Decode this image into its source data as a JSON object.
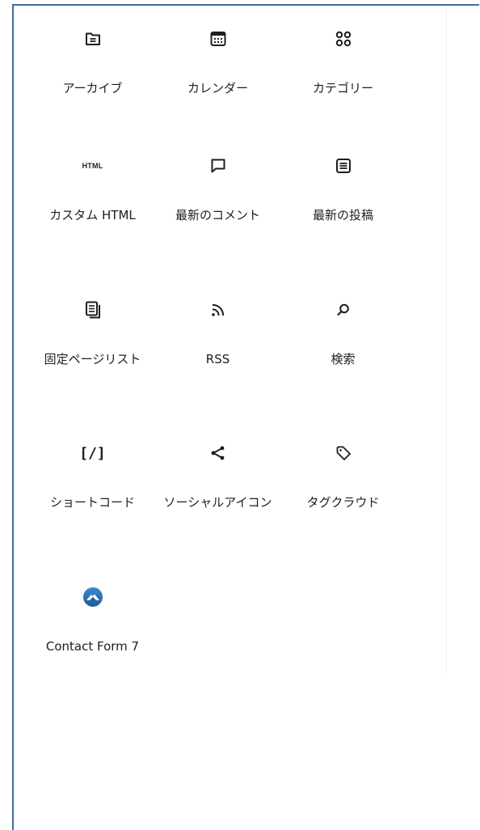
{
  "blocks": [
    {
      "label": "アーカイブ",
      "icon": "archive-icon"
    },
    {
      "label": "カレンダー",
      "icon": "calendar-icon"
    },
    {
      "label": "カテゴリー",
      "icon": "categories-icon"
    },
    {
      "label": "カスタム HTML",
      "icon": "html-icon",
      "icon_text": "HTML"
    },
    {
      "label": "最新のコメント",
      "icon": "comment-icon"
    },
    {
      "label": "最新の投稿",
      "icon": "post-list-icon"
    },
    {
      "label": "固定ページリスト",
      "icon": "pages-icon"
    },
    {
      "label": "RSS",
      "icon": "rss-icon"
    },
    {
      "label": "検索",
      "icon": "search-icon"
    },
    {
      "label": "ショートコード",
      "icon": "shortcode-icon",
      "icon_text": "[/]"
    },
    {
      "label": "ソーシャルアイコン",
      "icon": "share-icon"
    },
    {
      "label": "タグクラウド",
      "icon": "tag-icon"
    },
    {
      "label": "Contact Form 7",
      "icon": "contact-form-7-icon"
    }
  ],
  "colors": {
    "frame_border": "#3d6e9e",
    "icon": "#1e1e1e",
    "cf7_blue": "#2d6fb5"
  }
}
